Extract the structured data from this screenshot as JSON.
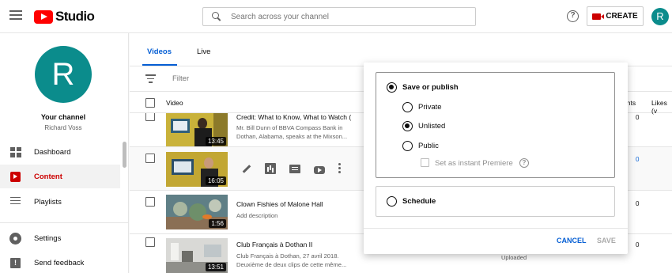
{
  "header": {
    "logo_text": "Studio",
    "search_placeholder": "Search across your channel",
    "help_symbol": "?",
    "create_label": "CREATE",
    "avatar_letter": "R"
  },
  "sidebar": {
    "avatar_letter": "R",
    "channel_title": "Your channel",
    "channel_name": "Richard Voss",
    "items": [
      {
        "label": "Dashboard",
        "icon": "dashboard-icon",
        "active": false
      },
      {
        "label": "Content",
        "icon": "content-icon",
        "active": true
      },
      {
        "label": "Playlists",
        "icon": "playlists-icon",
        "active": false
      },
      {
        "label": "Settings",
        "icon": "gear-icon",
        "active": false
      },
      {
        "label": "Send feedback",
        "icon": "feedback-icon",
        "active": false
      }
    ]
  },
  "main": {
    "tabs": [
      {
        "label": "Videos",
        "active": true
      },
      {
        "label": "Live",
        "active": false
      }
    ],
    "filter_label": "Filter",
    "columns": {
      "video": "Video",
      "comments": "ents",
      "likes": "Likes (v"
    },
    "videos": [
      {
        "title": "Credit: What to Know, What to Watch (",
        "description": "Mr. Bill Dunn of BBVA Compass Bank in Dothan, Alabama, speaks at the Mixson...",
        "duration": "13:45",
        "comments": "0"
      },
      {
        "title": "",
        "description": "",
        "duration": "16:05",
        "comments": "0"
      },
      {
        "title": "Clown Fishies of Malone Hall",
        "description": "Add description",
        "duration": "1:56",
        "comments": "0"
      },
      {
        "title": "Club Français à Dothan II",
        "description": "Club Français à Dothan, 27 avril 2018. Deuxième de deux clips de cette même...",
        "duration": "13:51",
        "comments": "0",
        "status": "Uploaded"
      }
    ]
  },
  "visibility_popup": {
    "save_or_publish": "Save or publish",
    "options": [
      {
        "label": "Private",
        "selected": false
      },
      {
        "label": "Unlisted",
        "selected": true
      },
      {
        "label": "Public",
        "selected": false
      }
    ],
    "premiere_label": "Set as instant Premiere",
    "premiere_help": "?",
    "schedule": "Schedule",
    "cancel": "CANCEL",
    "save": "SAVE"
  },
  "colors": {
    "brand_red": "#ff0000",
    "accent_blue": "#065fd4",
    "avatar_teal": "#0b8c8c",
    "active_red": "#cc0000"
  }
}
